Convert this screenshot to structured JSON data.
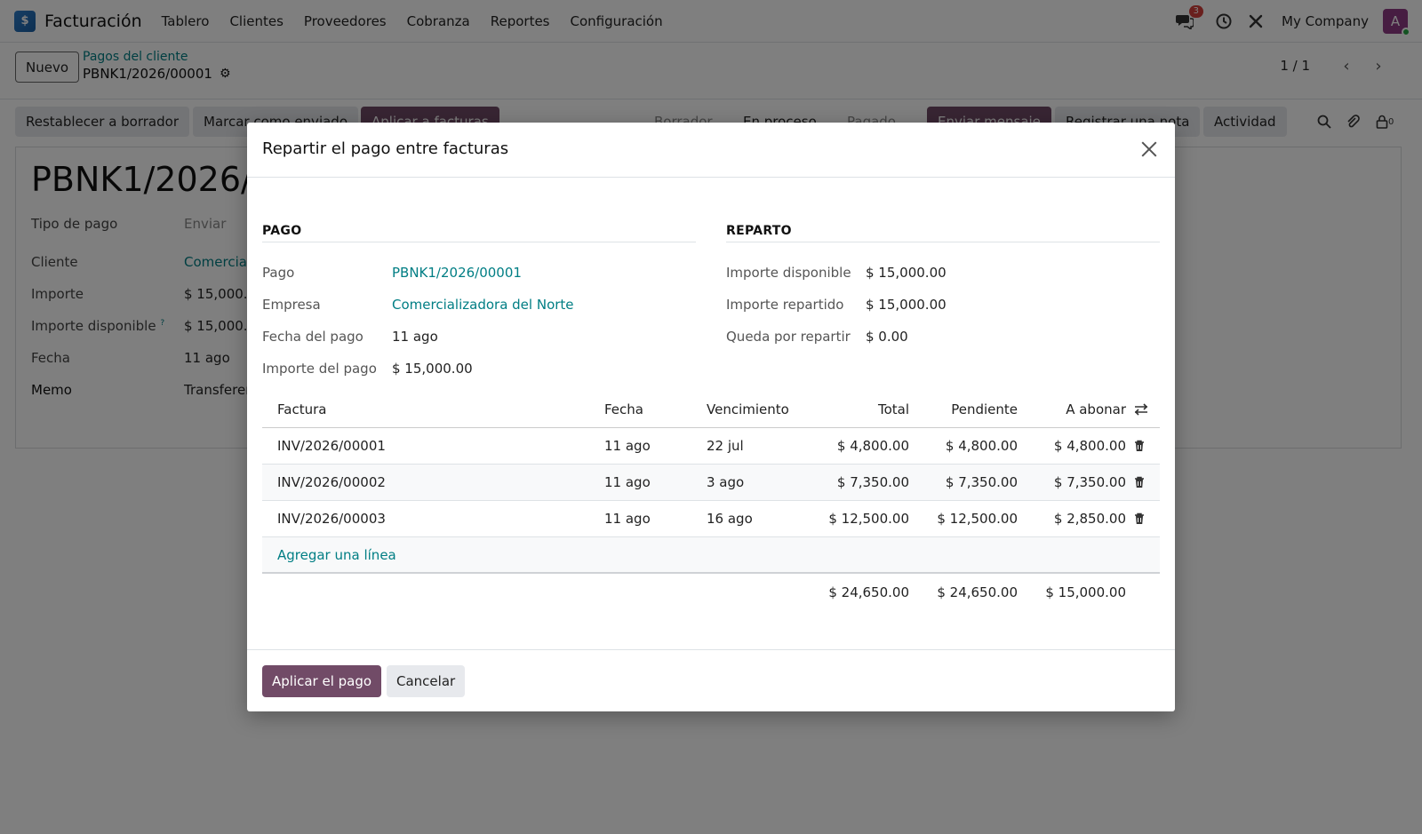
{
  "navbar": {
    "app_name": "Facturación",
    "menu": [
      "Tablero",
      "Clientes",
      "Proveedores",
      "Cobranza",
      "Reportes",
      "Configuración"
    ],
    "messages_count": "3",
    "company": "My Company",
    "avatar_initial": "A"
  },
  "control_panel": {
    "new_label": "Nuevo",
    "breadcrumb_parent": "Pagos del cliente",
    "breadcrumb_current": "PBNK1/2026/00001",
    "pager": "1 / 1"
  },
  "status_bar": {
    "reset_label": "Restablecer a borrador",
    "mark_sent_label": "Marcar como enviado",
    "apply_invoices_label": "Aplicar a facturas",
    "stages": [
      "Borrador",
      "En proceso",
      "Pagado"
    ],
    "send_message_label": "Enviar mensaje",
    "log_note_label": "Registrar una nota",
    "activity_label": "Actividad",
    "followers_count": "0"
  },
  "form": {
    "title": "PBNK1/2026/0",
    "payment_type_label": "Tipo de pago",
    "payment_type_value": "Enviar",
    "customer_label": "Cliente",
    "customer_value": "Comercia",
    "amount_label": "Importe",
    "amount_value": "$ 15,000.",
    "available_label": "Importe disponible",
    "available_tooltip": "?",
    "available_value": "$ 15,000.",
    "date_label": "Fecha",
    "date_value": "11 ago",
    "memo_label": "Memo",
    "memo_value": "Transferen"
  },
  "modal": {
    "title": "Repartir el pago entre facturas",
    "payment_section": {
      "title": "PAGO",
      "payment_label": "Pago",
      "payment_value": "PBNK1/2026/00001",
      "company_label": "Empresa",
      "company_value": "Comercializadora del Norte",
      "date_label": "Fecha del pago",
      "date_value": "11 ago",
      "amount_label": "Importe del pago",
      "amount_value": "$ 15,000.00"
    },
    "allocation_section": {
      "title": "REPARTO",
      "available_label": "Importe disponible",
      "available_value": "$ 15,000.00",
      "allocated_label": "Importe repartido",
      "allocated_value": "$ 15,000.00",
      "remaining_label": "Queda por repartir",
      "remaining_value": "$ 0.00"
    },
    "table": {
      "headers": {
        "invoice": "Factura",
        "date": "Fecha",
        "due": "Vencimiento",
        "total": "Total",
        "pending": "Pendiente",
        "apply": "A abonar"
      },
      "rows": [
        {
          "invoice": "INV/2026/00001",
          "date": "11 ago",
          "due": "22 jul",
          "total": "$ 4,800.00",
          "pending": "$ 4,800.00",
          "apply": "$ 4,800.00"
        },
        {
          "invoice": "INV/2026/00002",
          "date": "11 ago",
          "due": "3 ago",
          "total": "$ 7,350.00",
          "pending": "$ 7,350.00",
          "apply": "$ 7,350.00"
        },
        {
          "invoice": "INV/2026/00003",
          "date": "11 ago",
          "due": "16 ago",
          "total": "$ 12,500.00",
          "pending": "$ 12,500.00",
          "apply": "$ 2,850.00"
        }
      ],
      "add_line_label": "Agregar una línea",
      "totals": {
        "total": "$ 24,650.00",
        "pending": "$ 24,650.00",
        "apply": "$ 15,000.00"
      }
    },
    "footer": {
      "apply_label": "Aplicar el pago",
      "cancel_label": "Cancelar"
    }
  },
  "colors": {
    "primary": "#714b67",
    "link": "#017e84",
    "badge": "#d23f3a"
  }
}
